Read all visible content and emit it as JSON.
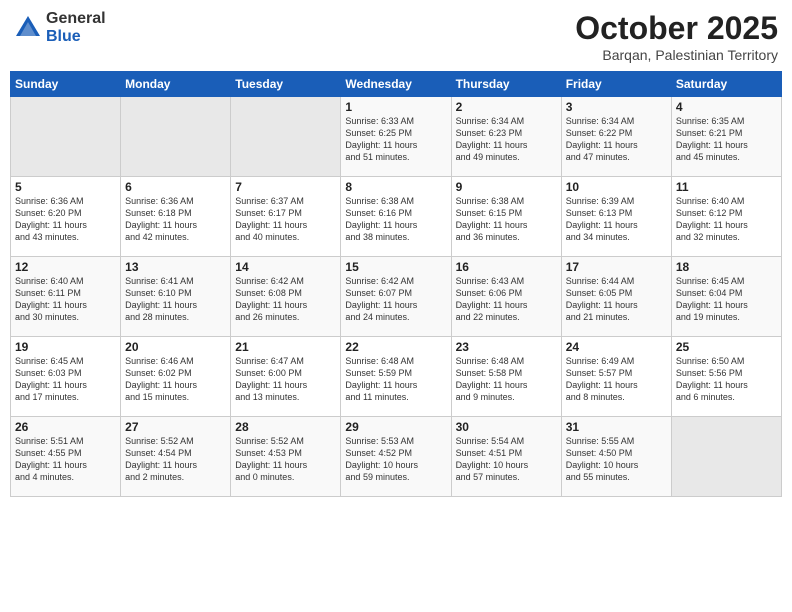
{
  "logo": {
    "general": "General",
    "blue": "Blue"
  },
  "header": {
    "month": "October 2025",
    "location": "Barqan, Palestinian Territory"
  },
  "weekdays": [
    "Sunday",
    "Monday",
    "Tuesday",
    "Wednesday",
    "Thursday",
    "Friday",
    "Saturday"
  ],
  "weeks": [
    [
      {
        "day": "",
        "content": ""
      },
      {
        "day": "",
        "content": ""
      },
      {
        "day": "",
        "content": ""
      },
      {
        "day": "1",
        "content": "Sunrise: 6:33 AM\nSunset: 6:25 PM\nDaylight: 11 hours\nand 51 minutes."
      },
      {
        "day": "2",
        "content": "Sunrise: 6:34 AM\nSunset: 6:23 PM\nDaylight: 11 hours\nand 49 minutes."
      },
      {
        "day": "3",
        "content": "Sunrise: 6:34 AM\nSunset: 6:22 PM\nDaylight: 11 hours\nand 47 minutes."
      },
      {
        "day": "4",
        "content": "Sunrise: 6:35 AM\nSunset: 6:21 PM\nDaylight: 11 hours\nand 45 minutes."
      }
    ],
    [
      {
        "day": "5",
        "content": "Sunrise: 6:36 AM\nSunset: 6:20 PM\nDaylight: 11 hours\nand 43 minutes."
      },
      {
        "day": "6",
        "content": "Sunrise: 6:36 AM\nSunset: 6:18 PM\nDaylight: 11 hours\nand 42 minutes."
      },
      {
        "day": "7",
        "content": "Sunrise: 6:37 AM\nSunset: 6:17 PM\nDaylight: 11 hours\nand 40 minutes."
      },
      {
        "day": "8",
        "content": "Sunrise: 6:38 AM\nSunset: 6:16 PM\nDaylight: 11 hours\nand 38 minutes."
      },
      {
        "day": "9",
        "content": "Sunrise: 6:38 AM\nSunset: 6:15 PM\nDaylight: 11 hours\nand 36 minutes."
      },
      {
        "day": "10",
        "content": "Sunrise: 6:39 AM\nSunset: 6:13 PM\nDaylight: 11 hours\nand 34 minutes."
      },
      {
        "day": "11",
        "content": "Sunrise: 6:40 AM\nSunset: 6:12 PM\nDaylight: 11 hours\nand 32 minutes."
      }
    ],
    [
      {
        "day": "12",
        "content": "Sunrise: 6:40 AM\nSunset: 6:11 PM\nDaylight: 11 hours\nand 30 minutes."
      },
      {
        "day": "13",
        "content": "Sunrise: 6:41 AM\nSunset: 6:10 PM\nDaylight: 11 hours\nand 28 minutes."
      },
      {
        "day": "14",
        "content": "Sunrise: 6:42 AM\nSunset: 6:08 PM\nDaylight: 11 hours\nand 26 minutes."
      },
      {
        "day": "15",
        "content": "Sunrise: 6:42 AM\nSunset: 6:07 PM\nDaylight: 11 hours\nand 24 minutes."
      },
      {
        "day": "16",
        "content": "Sunrise: 6:43 AM\nSunset: 6:06 PM\nDaylight: 11 hours\nand 22 minutes."
      },
      {
        "day": "17",
        "content": "Sunrise: 6:44 AM\nSunset: 6:05 PM\nDaylight: 11 hours\nand 21 minutes."
      },
      {
        "day": "18",
        "content": "Sunrise: 6:45 AM\nSunset: 6:04 PM\nDaylight: 11 hours\nand 19 minutes."
      }
    ],
    [
      {
        "day": "19",
        "content": "Sunrise: 6:45 AM\nSunset: 6:03 PM\nDaylight: 11 hours\nand 17 minutes."
      },
      {
        "day": "20",
        "content": "Sunrise: 6:46 AM\nSunset: 6:02 PM\nDaylight: 11 hours\nand 15 minutes."
      },
      {
        "day": "21",
        "content": "Sunrise: 6:47 AM\nSunset: 6:00 PM\nDaylight: 11 hours\nand 13 minutes."
      },
      {
        "day": "22",
        "content": "Sunrise: 6:48 AM\nSunset: 5:59 PM\nDaylight: 11 hours\nand 11 minutes."
      },
      {
        "day": "23",
        "content": "Sunrise: 6:48 AM\nSunset: 5:58 PM\nDaylight: 11 hours\nand 9 minutes."
      },
      {
        "day": "24",
        "content": "Sunrise: 6:49 AM\nSunset: 5:57 PM\nDaylight: 11 hours\nand 8 minutes."
      },
      {
        "day": "25",
        "content": "Sunrise: 6:50 AM\nSunset: 5:56 PM\nDaylight: 11 hours\nand 6 minutes."
      }
    ],
    [
      {
        "day": "26",
        "content": "Sunrise: 5:51 AM\nSunset: 4:55 PM\nDaylight: 11 hours\nand 4 minutes."
      },
      {
        "day": "27",
        "content": "Sunrise: 5:52 AM\nSunset: 4:54 PM\nDaylight: 11 hours\nand 2 minutes."
      },
      {
        "day": "28",
        "content": "Sunrise: 5:52 AM\nSunset: 4:53 PM\nDaylight: 11 hours\nand 0 minutes."
      },
      {
        "day": "29",
        "content": "Sunrise: 5:53 AM\nSunset: 4:52 PM\nDaylight: 10 hours\nand 59 minutes."
      },
      {
        "day": "30",
        "content": "Sunrise: 5:54 AM\nSunset: 4:51 PM\nDaylight: 10 hours\nand 57 minutes."
      },
      {
        "day": "31",
        "content": "Sunrise: 5:55 AM\nSunset: 4:50 PM\nDaylight: 10 hours\nand 55 minutes."
      },
      {
        "day": "",
        "content": ""
      }
    ]
  ]
}
